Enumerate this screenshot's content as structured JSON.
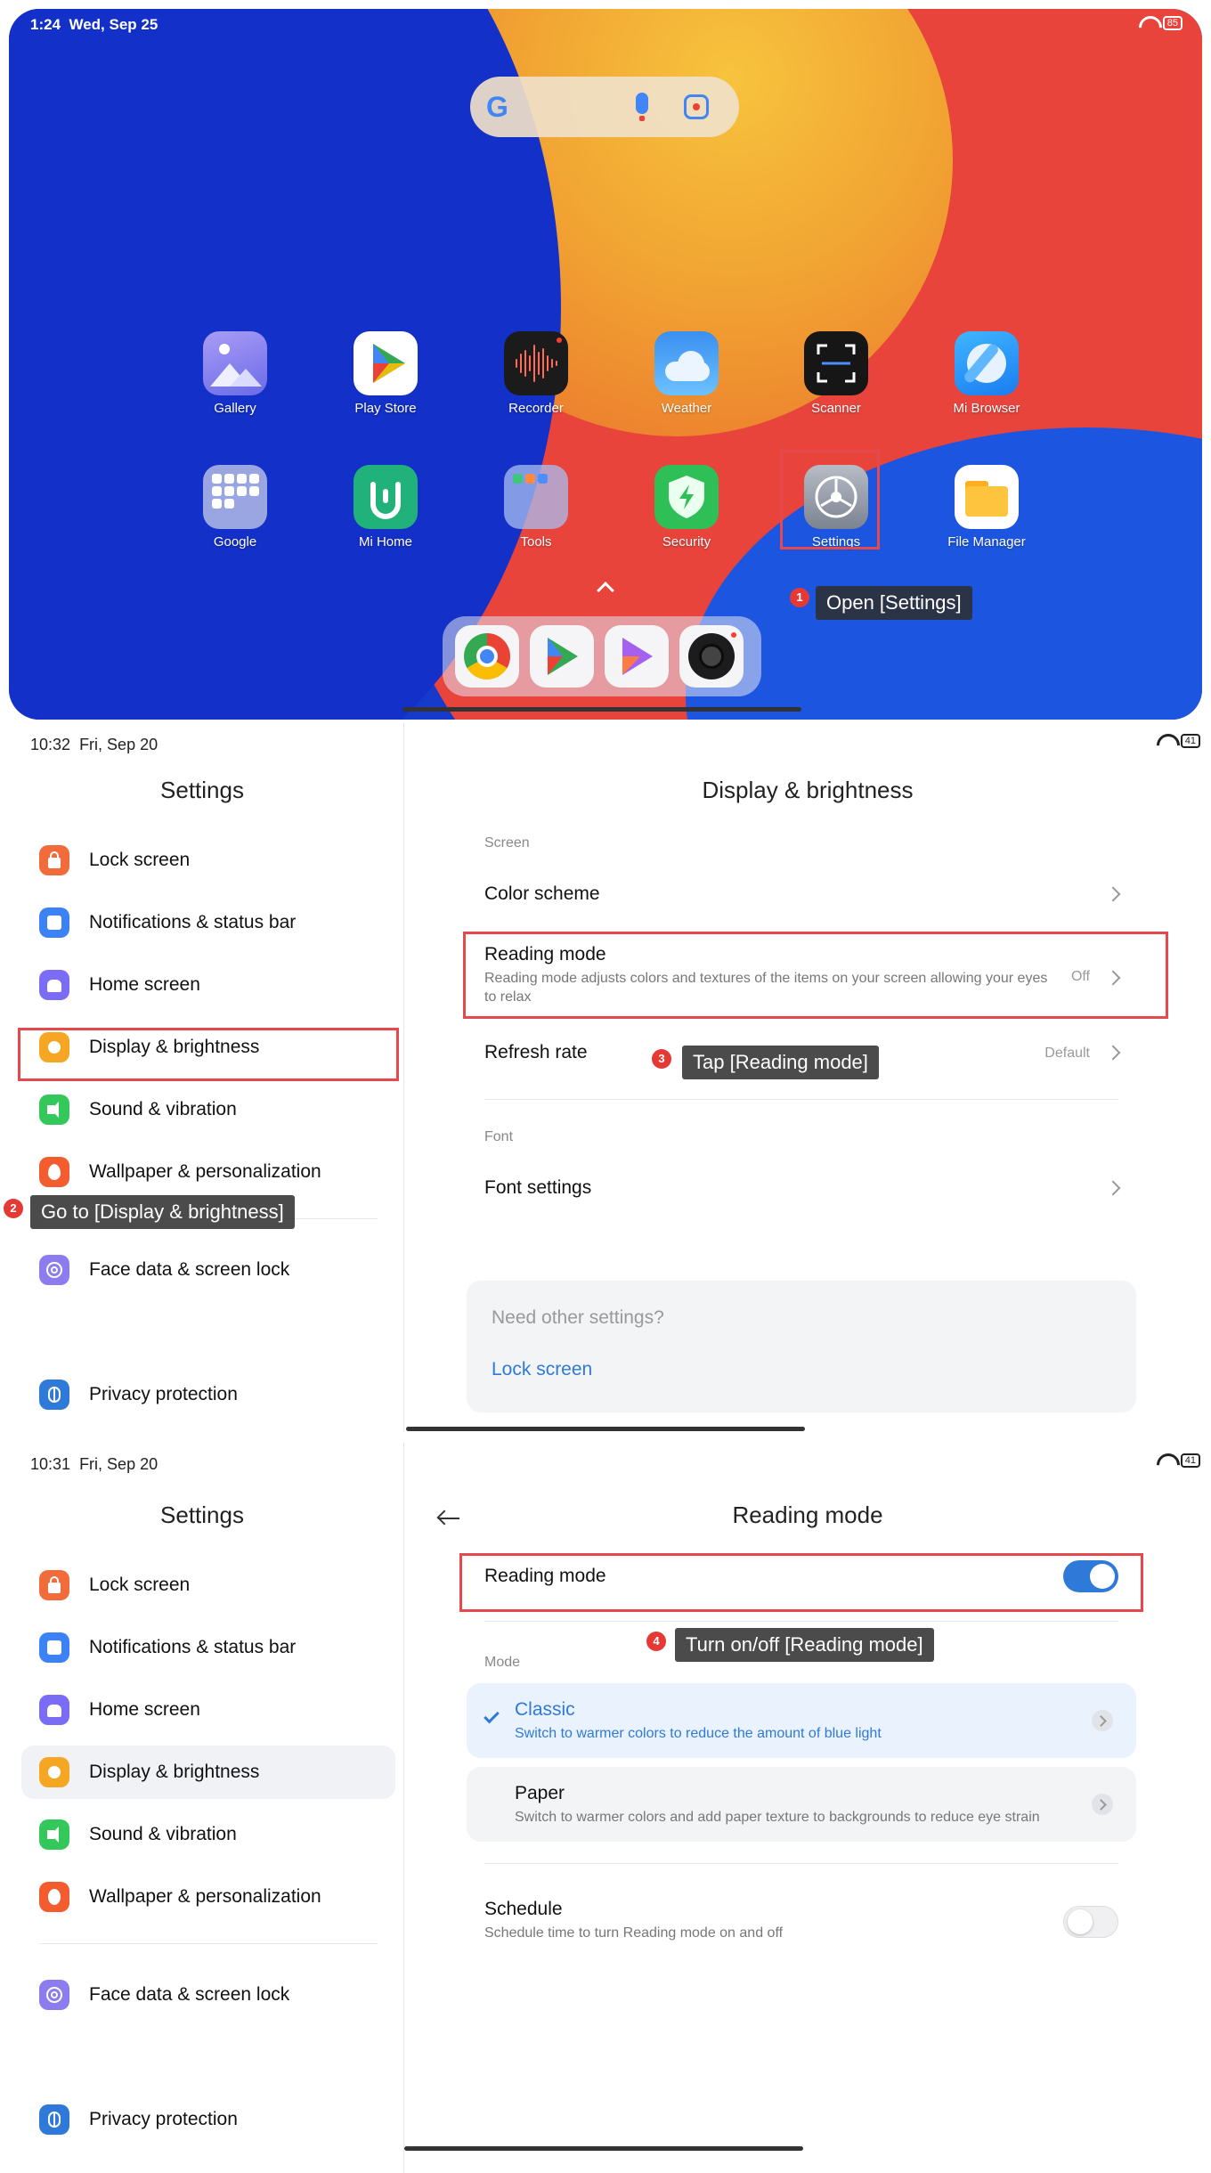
{
  "home": {
    "status_time": "1:24",
    "status_date": "Wed, Sep 25",
    "battery": "85",
    "search_logo": "G",
    "apps_row1": [
      {
        "label": "Gallery",
        "icon": "gallery-icon"
      },
      {
        "label": "Play Store",
        "icon": "play-store-icon"
      },
      {
        "label": "Recorder",
        "icon": "recorder-icon"
      },
      {
        "label": "Weather",
        "icon": "weather-icon"
      },
      {
        "label": "Scanner",
        "icon": "scanner-icon"
      },
      {
        "label": "Mi Browser",
        "icon": "mi-browser-icon"
      }
    ],
    "apps_row2": [
      {
        "label": "Google",
        "icon": "google-folder-icon"
      },
      {
        "label": "Mi Home",
        "icon": "mi-home-icon"
      },
      {
        "label": "Tools",
        "icon": "tools-folder-icon"
      },
      {
        "label": "Security",
        "icon": "security-icon"
      },
      {
        "label": "Settings",
        "icon": "settings-icon"
      },
      {
        "label": "File Manager",
        "icon": "file-manager-icon"
      }
    ],
    "dock": [
      "chrome-icon",
      "play-store-icon",
      "play-games-icon",
      "camera-icon"
    ],
    "step1": {
      "number": "1",
      "text": "Open [Settings]"
    }
  },
  "panel2": {
    "status_time": "10:32",
    "status_date": "Fri, Sep 20",
    "battery": "41",
    "sidebar_title": "Settings",
    "sidebar_items": [
      "Lock screen",
      "Notifications & status bar",
      "Home screen",
      "Display & brightness",
      "Sound & vibration",
      "Wallpaper & personalization",
      "Face data & screen lock",
      "Privacy protection"
    ],
    "main_title": "Display & brightness",
    "section_screen": "Screen",
    "color_scheme": "Color scheme",
    "reading_mode": {
      "title": "Reading mode",
      "desc": "Reading mode adjusts colors and textures of the items on your screen allowing your eyes to relax",
      "value": "Off"
    },
    "refresh_rate": {
      "title": "Refresh rate",
      "value": "Default"
    },
    "section_font": "Font",
    "font_settings": "Font settings",
    "other": {
      "question": "Need other settings?",
      "link": "Lock screen"
    },
    "step2": {
      "number": "2",
      "text": "Go to [Display & brightness]"
    },
    "step3": {
      "number": "3",
      "text": "Tap [Reading mode]"
    }
  },
  "panel3": {
    "status_time": "10:31",
    "status_date": "Fri, Sep 20",
    "battery": "41",
    "sidebar_title": "Settings",
    "sidebar_items": [
      "Lock screen",
      "Notifications & status bar",
      "Home screen",
      "Display & brightness",
      "Sound & vibration",
      "Wallpaper & personalization",
      "Face data & screen lock",
      "Privacy protection"
    ],
    "main_title": "Reading mode",
    "reading_mode_label": "Reading mode",
    "reading_mode_on": true,
    "section_mode": "Mode",
    "classic": {
      "title": "Classic",
      "desc": "Switch to warmer colors to reduce the amount of blue light"
    },
    "paper": {
      "title": "Paper",
      "desc": "Switch to warmer colors and add paper texture to backgrounds to reduce eye strain"
    },
    "schedule": {
      "title": "Schedule",
      "desc": "Schedule time to turn Reading mode on and off"
    },
    "schedule_on": false,
    "step4": {
      "number": "4",
      "text": "Turn on/off [Reading mode]"
    }
  },
  "colors": {
    "accent": "#2f7ad9",
    "annotation_red": "#e5484d",
    "tooltip_bg": "#2d2d2d"
  }
}
